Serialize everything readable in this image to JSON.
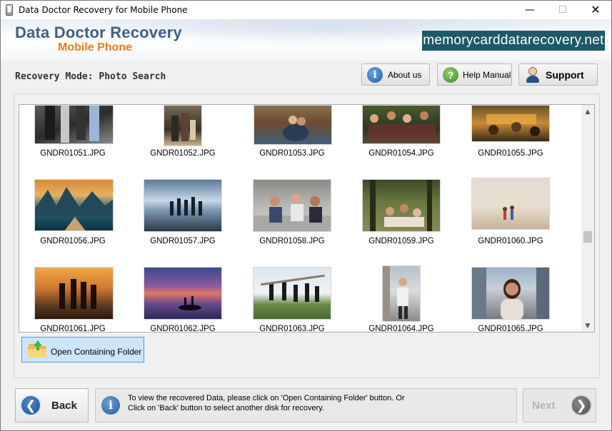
{
  "window": {
    "title": "Data Doctor Recovery for Mobile Phone",
    "minimize_glyph": "—",
    "maximize_glyph": "☐",
    "close_glyph": "✕"
  },
  "header": {
    "brand_main": "Data Doctor Recovery",
    "brand_sub": "Mobile Phone",
    "website": "memorycarddatarecovery.net",
    "brand_color": "#3f5f85",
    "sub_color": "#f07a1e",
    "badge_color": "#1d5968"
  },
  "toolbar": {
    "mode_label": "Recovery Mode: Photo Search",
    "about_label": "About us",
    "help_label": "Help Manual",
    "support_label": "Support"
  },
  "gallery": {
    "items": [
      {
        "name": "GNDR01051.JPG"
      },
      {
        "name": "GNDR01052.JPG"
      },
      {
        "name": "GNDR01053.JPG"
      },
      {
        "name": "GNDR01054.JPG"
      },
      {
        "name": "GNDR01055.JPG"
      },
      {
        "name": "GNDR01056.JPG"
      },
      {
        "name": "GNDR01057.JPG"
      },
      {
        "name": "GNDR01058.JPG"
      },
      {
        "name": "GNDR01059.JPG"
      },
      {
        "name": "GNDR01060.JPG"
      },
      {
        "name": "GNDR01061.JPG"
      },
      {
        "name": "GNDR01062.JPG"
      },
      {
        "name": "GNDR01063.JPG"
      },
      {
        "name": "GNDR01064.JPG"
      },
      {
        "name": "GNDR01065.JPG"
      }
    ],
    "open_folder_label": "Open Containing Folder"
  },
  "footer": {
    "back_label": "Back",
    "info_line1": "To view the recovered Data, please click on 'Open Containing Folder' button. Or",
    "info_line2": "Click on 'Back' button to select another disk for recovery.",
    "next_label": "Next"
  }
}
